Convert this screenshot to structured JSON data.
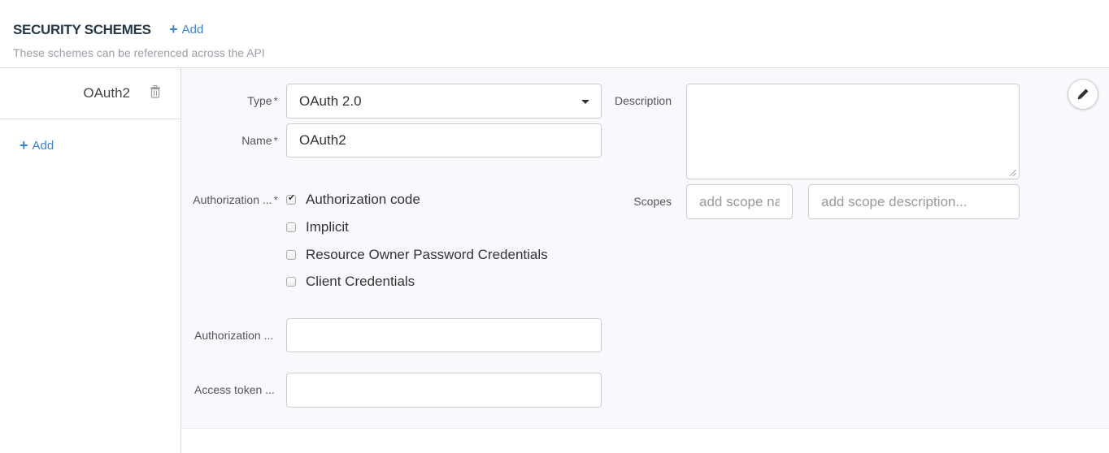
{
  "header": {
    "title": "SECURITY SCHEMES",
    "add_label": "Add",
    "subtitle": "These schemes can be referenced across the API"
  },
  "sidebar": {
    "items": [
      {
        "name": "OAuth2"
      }
    ],
    "add_label": "Add"
  },
  "form": {
    "type": {
      "label": "Type",
      "required_mark": "*",
      "value": "OAuth 2.0"
    },
    "name": {
      "label": "Name",
      "required_mark": "*",
      "value": "OAuth2"
    },
    "description": {
      "label": "Description",
      "value": ""
    },
    "scopes": {
      "label": "Scopes",
      "name_placeholder": "add scope name...",
      "description_placeholder": "add scope description..."
    },
    "flows": {
      "label": "Authorization ...",
      "required_mark": "*",
      "options": [
        {
          "label": "Authorization code",
          "checked": true
        },
        {
          "label": "Implicit",
          "checked": false
        },
        {
          "label": "Resource Owner Password Credentials",
          "checked": false
        },
        {
          "label": "Client Credentials",
          "checked": false
        }
      ]
    },
    "authorization_url": {
      "label": "Authorization ...",
      "value": ""
    },
    "access_token_url": {
      "label": "Access token ...",
      "value": ""
    }
  },
  "colors": {
    "accent": "#3a84d6",
    "title": "#263746",
    "panel_bg": "#f9f9fd"
  }
}
